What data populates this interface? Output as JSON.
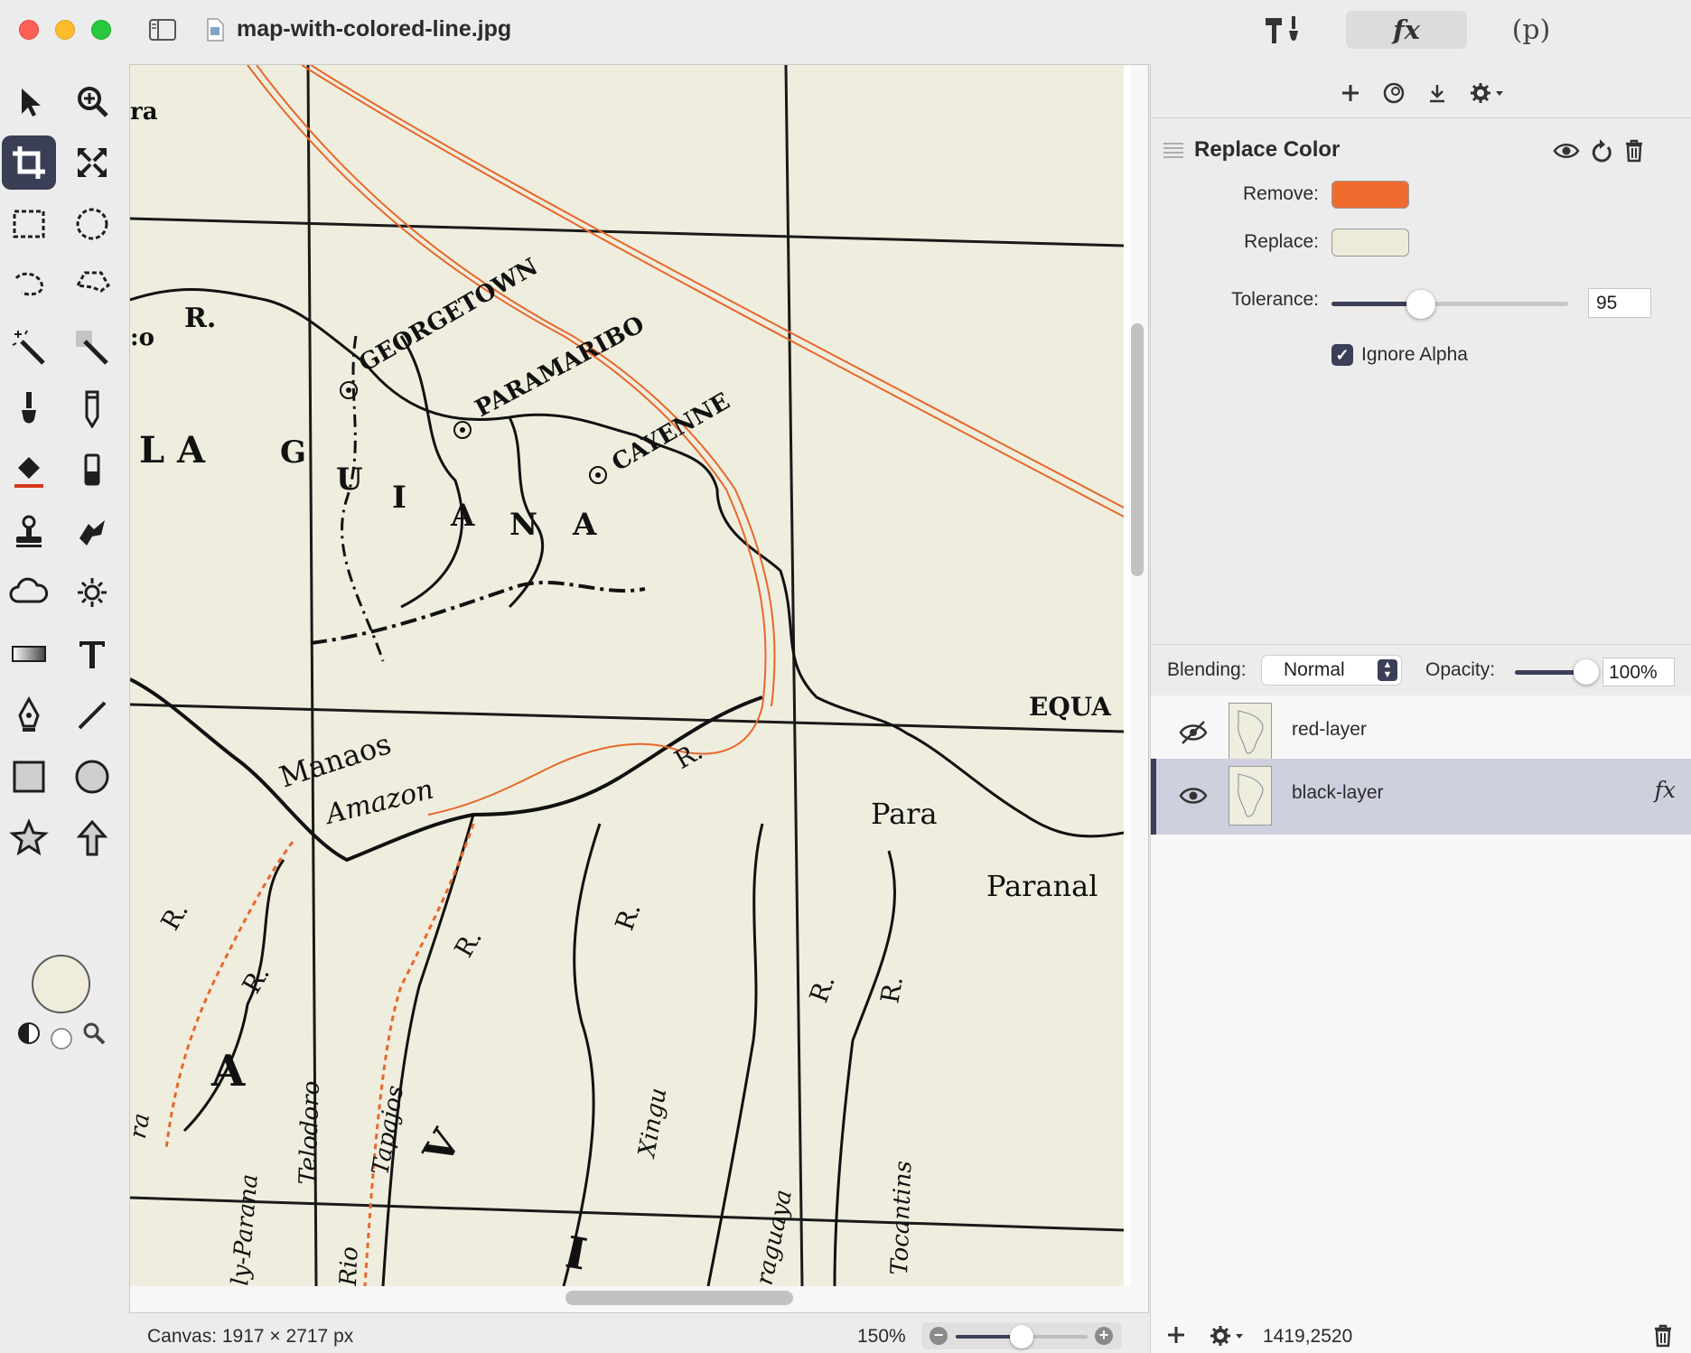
{
  "window": {
    "title": "map-with-colored-line.jpg"
  },
  "toolbar": {
    "fx_label": "fx",
    "p_label": "(p)"
  },
  "tools": [
    "arrow-select",
    "zoom",
    "crop",
    "scale",
    "rect-select",
    "ellipse-select",
    "lasso",
    "polygon-lasso",
    "magic-wand",
    "color-wand",
    "brush",
    "pencil",
    "paint-bucket",
    "eraser",
    "clone-stamp",
    "smudge",
    "blur-cloud",
    "sun-brightness",
    "gradient",
    "text",
    "pen",
    "line",
    "rectangle",
    "ellipse",
    "star",
    "arrow-shape"
  ],
  "colors": {
    "foreground": "#efecdc",
    "accent": "#3b3f57",
    "remove": "#ef6c2e",
    "replace": "#ecebd9",
    "map_paper": "#efeede",
    "map_route": "#e8672c"
  },
  "map": {
    "labels": {
      "georgetown": "GEORGETOWN",
      "paramaribo": "PARAMARIBO",
      "cayenne": "CAYENNE",
      "guiana_g": "G",
      "guiana_u": "U",
      "guiana_i": "I",
      "guiana_a1": "A",
      "guiana_n": "N",
      "guiana_a2": "A",
      "la": "L A",
      "r_top": "R.",
      "zo": ":o",
      "ra": "ra",
      "equator": "EQUA",
      "manaos": "Manaos",
      "amazon": "Amazon",
      "para": "Para",
      "paranal": "Paranal",
      "r1": "R.",
      "r2": "R.",
      "r3": "R.",
      "r4": "R.",
      "r5": "R.",
      "r6": "R.",
      "r7": "R.",
      "telodoro": "Telodoro",
      "tapajos": "Tapajos",
      "xingu": "Xingu",
      "araguaya": "raguaya",
      "tocantins": "Tocantins",
      "parana": "ly-Parana",
      "big_a": "A",
      "rio": "Rio",
      "ra2": "ra",
      "big_i": "I",
      "big_v": "V"
    }
  },
  "status": {
    "canvas": "Canvas: 1917 × 2717 px",
    "zoom": "150%",
    "coords": "1419,2520"
  },
  "filter": {
    "title": "Replace Color",
    "remove_label": "Remove:",
    "replace_label": "Replace:",
    "tolerance_label": "Tolerance:",
    "tolerance_value": "95",
    "ignore_alpha_label": "Ignore Alpha",
    "ignore_alpha": true
  },
  "blending": {
    "label": "Blending:",
    "mode": "Normal",
    "opacity_label": "Opacity:",
    "opacity": "100%"
  },
  "layers": [
    {
      "name": "red-layer",
      "visible": false,
      "selected": false
    },
    {
      "name": "black-layer",
      "visible": true,
      "selected": true,
      "fx": "fx"
    }
  ]
}
